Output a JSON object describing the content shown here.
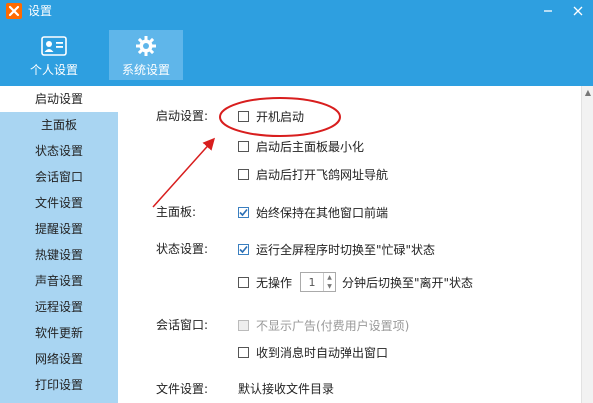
{
  "window": {
    "title": "设置",
    "logo_icon": "app-logo-icon",
    "controls": [
      "minimize-icon",
      "close-icon"
    ]
  },
  "top_tabs": [
    {
      "label": "个人设置",
      "icon": "id-card-icon",
      "active": false
    },
    {
      "label": "系统设置",
      "icon": "gear-icon",
      "active": true
    }
  ],
  "sidebar": {
    "items": [
      {
        "label": "启动设置",
        "active": true
      },
      {
        "label": "主面板"
      },
      {
        "label": "状态设置"
      },
      {
        "label": "会话窗口"
      },
      {
        "label": "文件设置"
      },
      {
        "label": "提醒设置"
      },
      {
        "label": "热键设置"
      },
      {
        "label": "声音设置"
      },
      {
        "label": "远程设置"
      },
      {
        "label": "软件更新"
      },
      {
        "label": "网络设置"
      },
      {
        "label": "打印设置"
      }
    ]
  },
  "content": {
    "startup": {
      "label": "启动设置:",
      "options": [
        {
          "label": "开机启动",
          "checked": false
        },
        {
          "label": "启动后主面板最小化",
          "checked": false
        },
        {
          "label": "启动后打开飞鸽网址导航",
          "checked": false
        }
      ]
    },
    "main_panel": {
      "label": "主面板:",
      "options": [
        {
          "label": "始终保持在其他窗口前端",
          "checked": true
        }
      ]
    },
    "status": {
      "label": "状态设置:",
      "busy_option": {
        "label": "运行全屏程序时切换至\"忙碌\"状态",
        "checked": true
      },
      "idle_option": {
        "prefix": "无操作",
        "minutes": "1",
        "suffix": "分钟后切换至\"离开\"状态",
        "checked": false
      }
    },
    "session": {
      "label": "会话窗口:",
      "options": [
        {
          "label": "不显示广告(付费用户设置项)",
          "checked": false,
          "disabled": true
        },
        {
          "label": "收到消息时自动弹出窗口",
          "checked": false
        }
      ]
    },
    "file": {
      "label": "文件设置:",
      "text": "默认接收文件目录"
    }
  },
  "colors": {
    "header": "#2e9fe0",
    "active_tab": "#5fb6ea",
    "sidebar": "#a9d5f2",
    "annotation": "#d81e1e",
    "checkmark": "#2a6fb5"
  }
}
